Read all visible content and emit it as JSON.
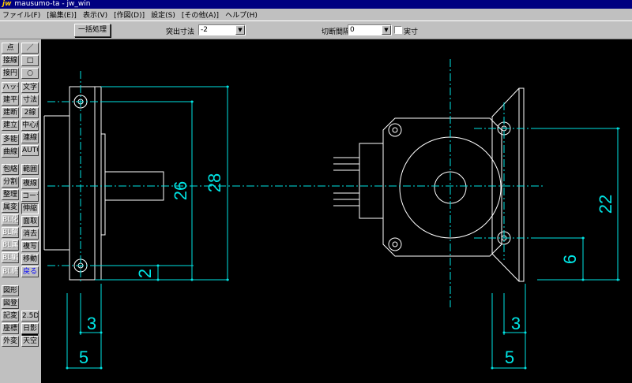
{
  "title_bar": {
    "logo": "jw",
    "title": "mausumo-ta - jw_win"
  },
  "menu": [
    "ファイル(F)",
    "[編集(E)]",
    "表示(V)",
    "[作図(D)]",
    "設定(S)",
    "[その他(A)]",
    "ヘルプ(H)"
  ],
  "toolbar": {
    "batch_label": "一括処理",
    "protrusion_label": "突出寸法",
    "protrusion_value": "-2",
    "cut_label": "切断間隔",
    "cut_value": "0",
    "actual_label": "実寸"
  },
  "palette": {
    "left": [
      "点",
      "接線",
      "接円",
      "ハッチ",
      "建平",
      "建断",
      "建立",
      "多能",
      "曲線",
      "包絡",
      "分割",
      "整理",
      "属変",
      "BL化",
      "BL解",
      "BL属",
      "BL編",
      "BL終",
      "図形",
      "図登",
      "記変",
      "座標",
      "外変"
    ],
    "right": [
      "／",
      "□",
      "○",
      "文字",
      "寸法",
      "2線",
      "中心線",
      "連線",
      "AUTO",
      "範囲",
      "複線",
      "コーナー",
      "伸縮",
      "面取",
      "消去",
      "複写",
      "移動",
      "戻る",
      "",
      "2.5D",
      "日影",
      "天空"
    ]
  },
  "drawing": {
    "colors": {
      "outline": "#ffffff",
      "dimension": "#00e5e5",
      "background": "#000000"
    },
    "dimensions": {
      "left_height_outer": "28",
      "left_height_inner": "26",
      "left_bottom": "2",
      "left_width_small": "3",
      "left_width": "5",
      "right_height": "22",
      "right_bottom": "6",
      "right_width_small": "3",
      "right_width": "5"
    }
  }
}
